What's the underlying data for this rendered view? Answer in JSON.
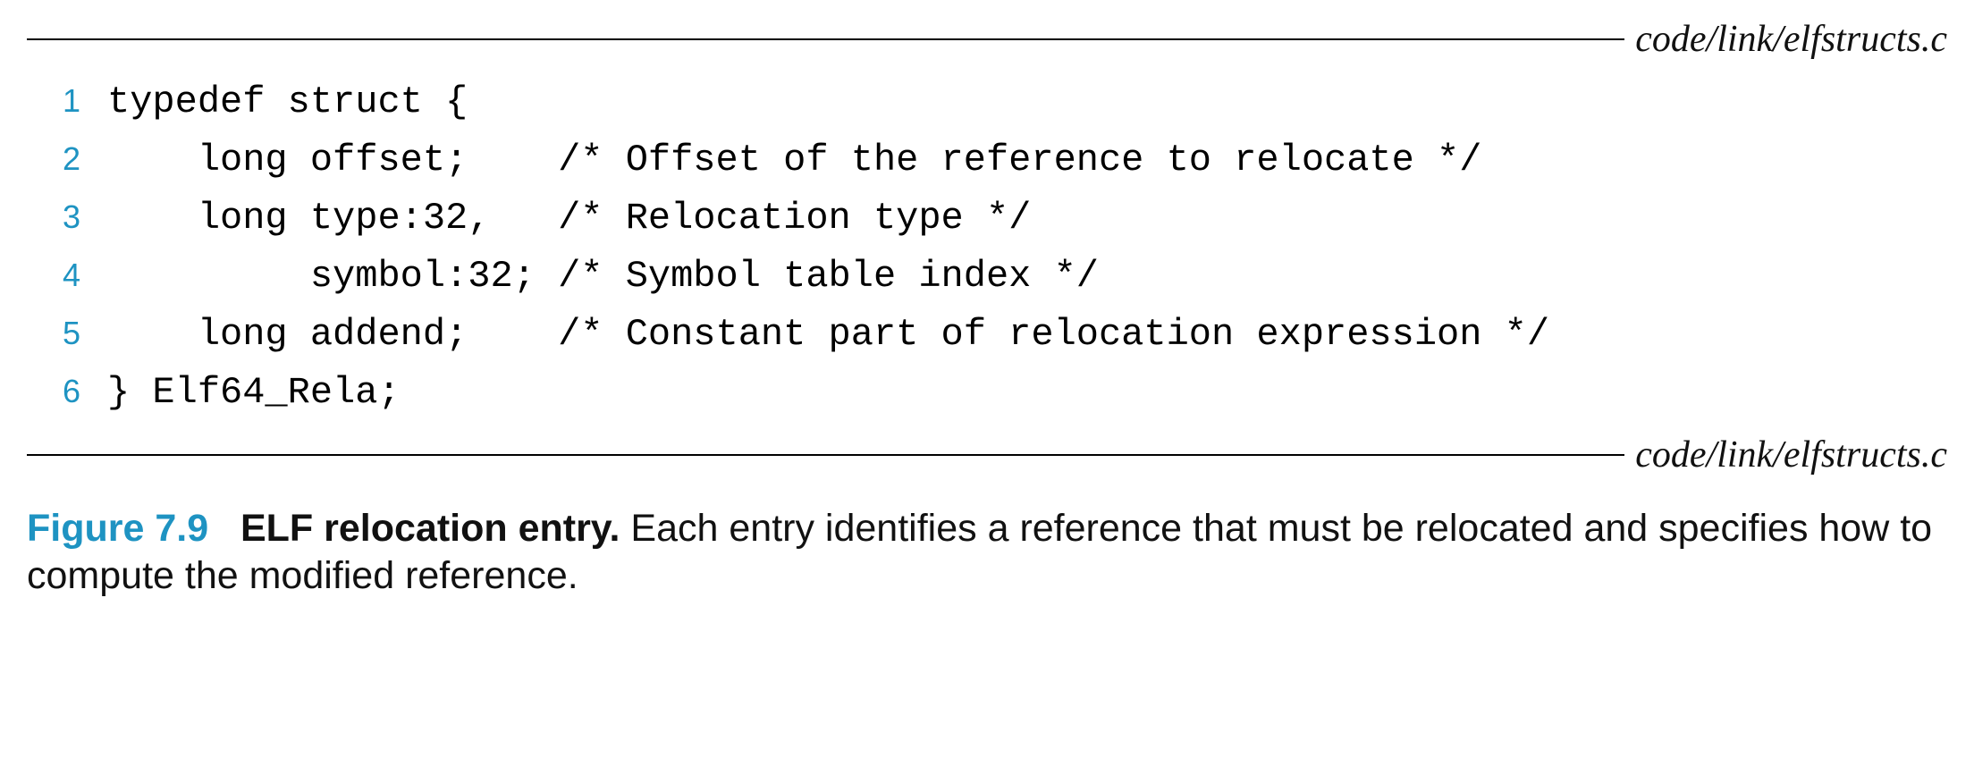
{
  "file_path_top": "code/link/elfstructs.c",
  "file_path_bottom": "code/link/elfstructs.c",
  "code": {
    "lines": [
      {
        "n": "1",
        "text": "typedef struct {"
      },
      {
        "n": "2",
        "text": "    long offset;    /* Offset of the reference to relocate */"
      },
      {
        "n": "3",
        "text": "    long type:32,   /* Relocation type */"
      },
      {
        "n": "4",
        "text": "         symbol:32; /* Symbol table index */"
      },
      {
        "n": "5",
        "text": "    long addend;    /* Constant part of relocation expression */"
      },
      {
        "n": "6",
        "text": "} Elf64_Rela;"
      }
    ]
  },
  "caption": {
    "label": "Figure 7.9",
    "title": "ELF relocation entry.",
    "body": "Each entry identifies a reference that must be relocated and specifies how to compute the modified reference."
  }
}
